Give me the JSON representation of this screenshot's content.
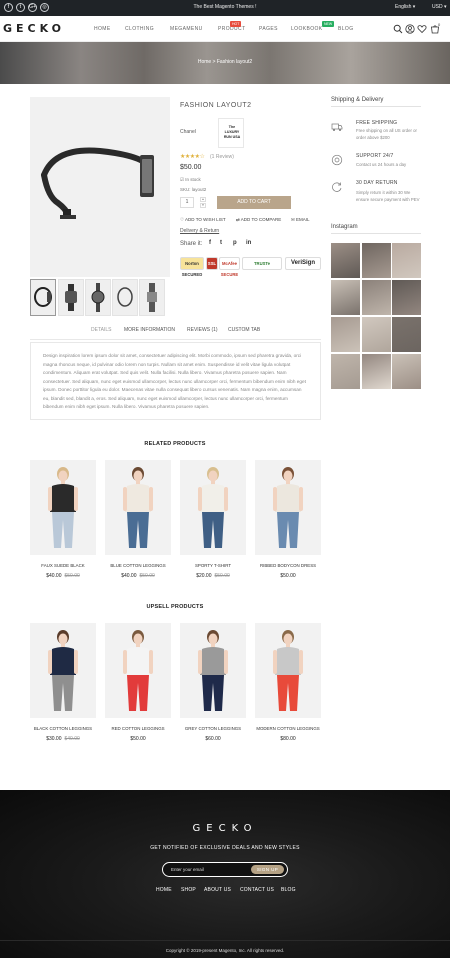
{
  "topbar": {
    "social": [
      "f",
      "t",
      "G+",
      "◎"
    ],
    "promo": "The Best Magento Themes !",
    "language": "English ▾",
    "currency": "USD ▾"
  },
  "header": {
    "logo": "GECKO",
    "nav": [
      "HOME",
      "CLOTHING",
      "MEGAMENU",
      "PRODUCT",
      "PAGES",
      "LOOKBOOK",
      "BLOG"
    ],
    "badges": {
      "product": "HOT",
      "lookbook": "NEW"
    },
    "cart_count": "0",
    "colors": {
      "hot": "#e74c3c",
      "new": "#27ae60"
    }
  },
  "hero": {
    "breadcrumb": "Home  >  Fashion layout2"
  },
  "product": {
    "title": "FASHION LAYOUT2",
    "brand_label": "Chanel",
    "brand_logo_text": "The LUXURY RUN USA",
    "rating": "★★★★☆",
    "review": "(1 Review)",
    "price": "$50.00",
    "stock": "☑ In stock",
    "sku": "SKU: layout2",
    "qty": "1",
    "add_to_cart": "ADD TO CART",
    "wishlist": "♡ ADD TO WISH LIST",
    "compare": "⇄ ADD TO COMPARE",
    "email": "✉ EMAIL",
    "delivery": "Delivery & Return",
    "share": "Share it:",
    "share_icons": [
      "f",
      "t",
      "p",
      "in"
    ],
    "trust_badges": [
      "Norton SECURED",
      "SSL",
      "McAfee SECURE",
      "TRUSTe",
      "VeriSign"
    ],
    "accent": "#b9a58b"
  },
  "sidebar": {
    "title": "Shipping & Delivery",
    "features": [
      {
        "title": "FREE SHIPPING",
        "desc": "Free shipping on all US order or order above $200"
      },
      {
        "title": "SUPPORT 24/7",
        "desc": "Contact us 24 hours a day"
      },
      {
        "title": "30 DAY RETURN",
        "desc": "Simply return it within 30 We ensure secure payment with PEV"
      }
    ],
    "instagram": "Instagram"
  },
  "tabs": [
    "DETAILS",
    "MORE INFORMATION",
    "REVIEWS (1)",
    "CUSTOM TAB"
  ],
  "description": "Design inspiration lorem ipsum dolor sit amet, consectetuer adipiscing elit. Morbi commodo, ipsum sed pharetra gravida, orci magna rhoncus neque, id pulvinar odio lorem non turpis. Nullam sit amet enim. Suspendisse id velit vitae ligula volutpat condimentum. Aliquam erat volutpat. Sed quis velit. Nulla facilisi. Nulla libero. Vivamus pharetra posuere sapien. Nam consectetuer. Sed aliquam, nunc eget euismod ullamcorper, lectus nunc ullamcorper orci, fermentum bibendum enim nibh eget ipsum. Donec porttitor ligula eu dolor. Maecenas vitae nulla consequat libero cursus venenatis. Nam magna enim, accumsan eu, blandit sed, blandit a, eros. Sed aliquam, nunc eget euismod ullamcorper, lectus nunc ullamcorper orci, fermentum bibendum enim nibh eget ipsum. Nulla libero. Vivamus pharetra posuere sapien.",
  "related": {
    "title": "RELATED PRODUCTS",
    "items": [
      {
        "name": "FAUX SUEDE BLACK",
        "price": "$40.00",
        "old": "$50.00"
      },
      {
        "name": "BLUE COTTON LEGGINGS",
        "price": "$40.00",
        "old": "$50.00"
      },
      {
        "name": "SPORTY T-SHIRT",
        "price": "$20.00",
        "old": "$50.00"
      },
      {
        "name": "RIBBED BODYCON DRESS",
        "price": "$50.00",
        "old": ""
      }
    ]
  },
  "upsell": {
    "title": "UPSELL PRODUCTS",
    "items": [
      {
        "name": "BLACK COTTON LEGGINGS",
        "price": "$30.00",
        "old": "$40.00"
      },
      {
        "name": "RED COTTON LEGGINGS",
        "price": "$50.00",
        "old": ""
      },
      {
        "name": "GREY COTTON LEGGINGS",
        "price": "$60.00",
        "old": ""
      },
      {
        "name": "MODERN COTTON LEGGINGS",
        "price": "$80.00",
        "old": ""
      }
    ]
  },
  "footer": {
    "logo": "GECKO",
    "notice": "GET NOTIFIED OF EXCLUSIVE DEALS AND NEW STYLES",
    "email_placeholder": "Enter your email",
    "signup": "SIGN UP",
    "links": [
      "HOME",
      "SHOP",
      "ABOUT US",
      "CONTACT US",
      "BLOG"
    ],
    "copyright": "Copyright © 2019-present Magento, Inc. All rights reserved."
  }
}
